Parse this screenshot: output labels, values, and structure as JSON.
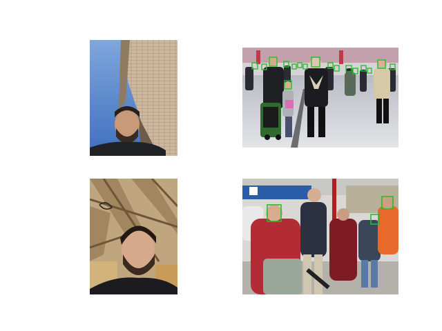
{
  "figure": {
    "layout": "2x2 image grid",
    "panels": [
      {
        "id": "selfie-building",
        "detections": 0
      },
      {
        "id": "station-crowd",
        "detections": 17,
        "box_color": "#22c02a"
      },
      {
        "id": "selfie-ceiling",
        "detections": 0
      },
      {
        "id": "street-crowd",
        "detections": 3,
        "box_color": "#22c02a"
      }
    ]
  }
}
